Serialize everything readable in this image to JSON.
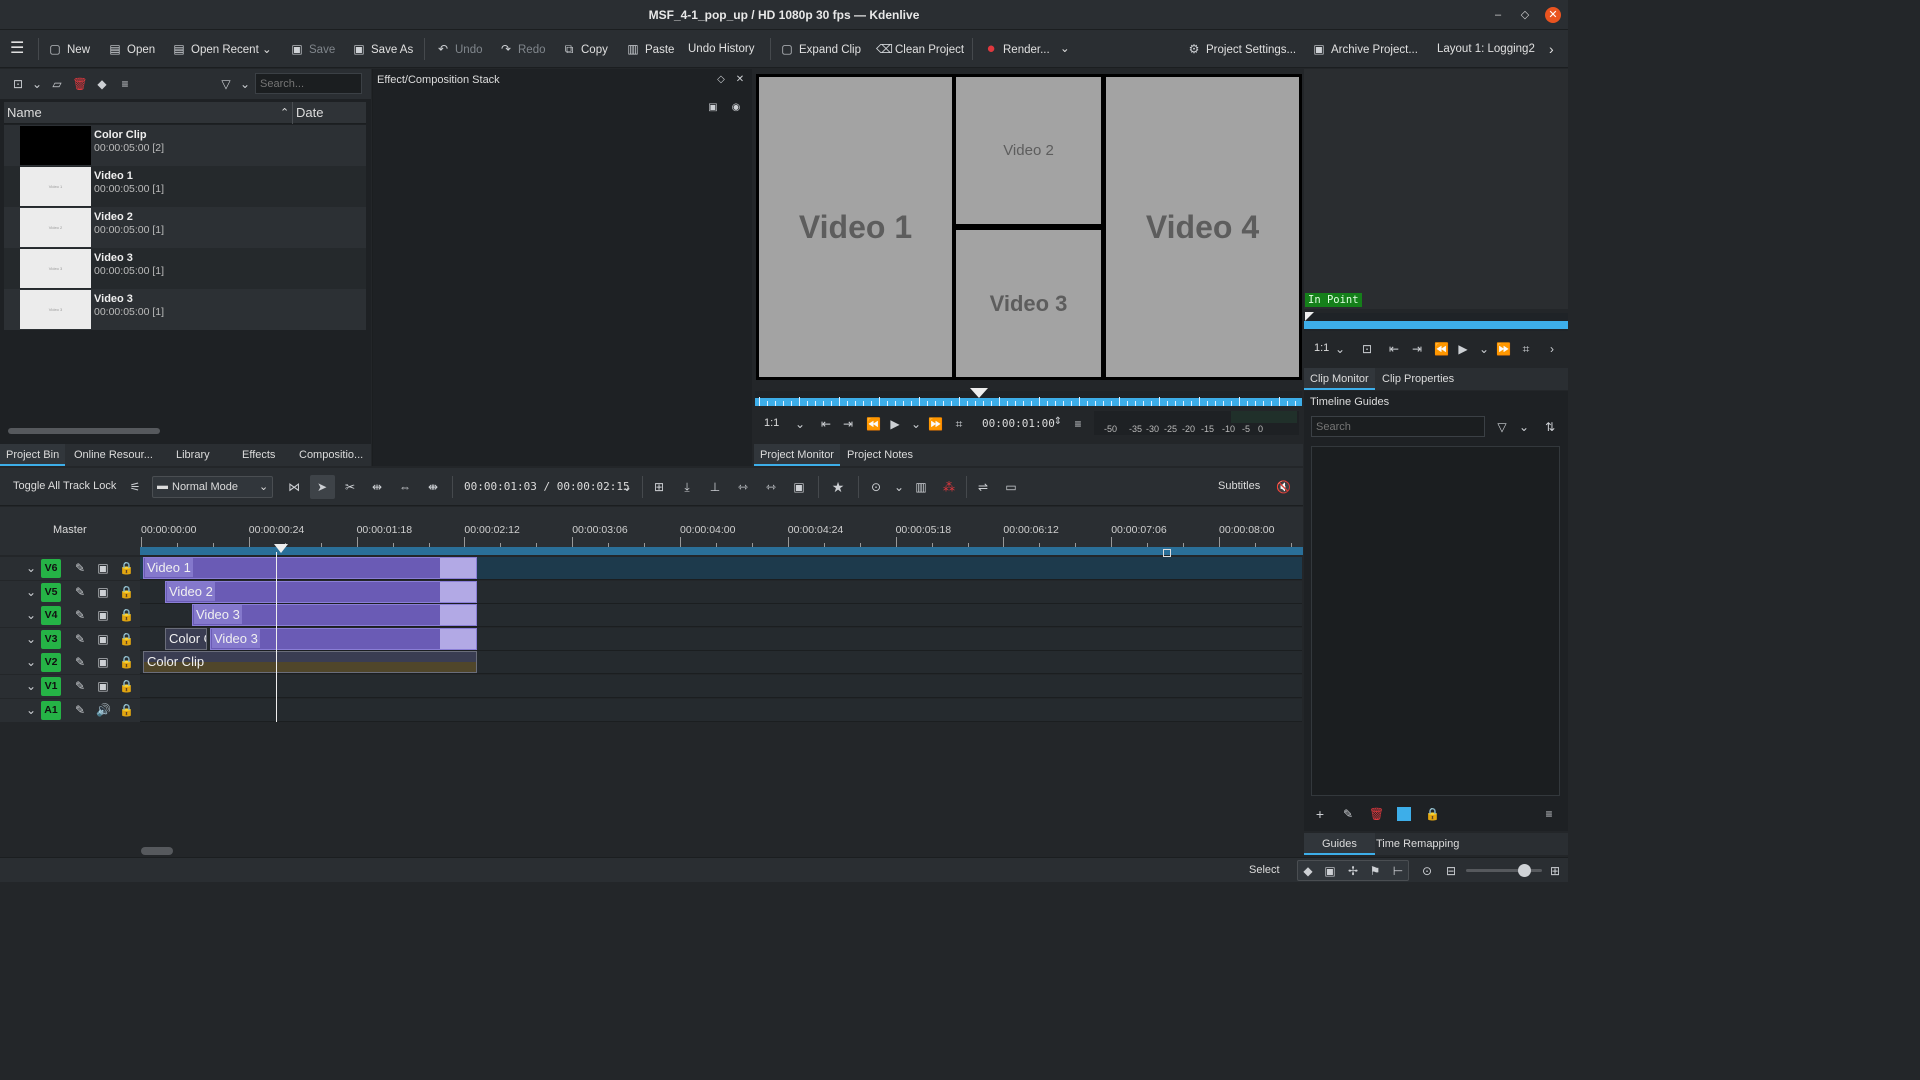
{
  "window": {
    "title": "MSF_4-1_pop_up / HD 1080p 30 fps — Kdenlive"
  },
  "toolbar": {
    "new": "New",
    "open": "Open",
    "open_recent": "Open Recent",
    "save": "Save",
    "save_as": "Save As",
    "undo": "Undo",
    "redo": "Redo",
    "copy": "Copy",
    "paste": "Paste",
    "undo_history": "Undo History",
    "expand_clip": "Expand Clip",
    "clean_project": "Clean Project",
    "render": "Render...",
    "project_settings": "Project Settings...",
    "archive_project": "Archive Project...",
    "layout": "Layout 1: Logging2"
  },
  "bin": {
    "search_placeholder": "Search...",
    "col_name": "Name",
    "col_date": "Date",
    "clips": [
      {
        "name": "Color Clip",
        "duration": "00:00:05:00 [2]",
        "thumb": ""
      },
      {
        "name": "Video 1",
        "duration": "00:00:05:00 [1]",
        "thumb": "Video 1"
      },
      {
        "name": "Video 2",
        "duration": "00:00:05:00 [1]",
        "thumb": "Video 2"
      },
      {
        "name": "Video 3",
        "duration": "00:00:05:00 [1]",
        "thumb": "Video 3"
      },
      {
        "name": "Video 3",
        "duration": "00:00:05:00 [1]",
        "thumb": "Video 3"
      }
    ],
    "tabs": [
      "Project Bin",
      "Online Resour...",
      "Library",
      "Effects",
      "Compositio..."
    ]
  },
  "effect_stack": {
    "title": "Effect/Composition Stack"
  },
  "project_monitor": {
    "tiles": [
      "Video 1",
      "Video 2",
      "Video 3",
      "Video 4"
    ],
    "zoom": "1:1",
    "timecode": "00:00:01:00",
    "scale": [
      "-50",
      "-35",
      "-30",
      "-25",
      "-20",
      "-15",
      "-10",
      "-5",
      "0"
    ],
    "playhead_fraction": 0.41,
    "tabs": [
      "Project Monitor",
      "Project Notes"
    ]
  },
  "clip_monitor": {
    "in_point": "In Point",
    "zoom": "1:1",
    "tabs": [
      "Clip Monitor",
      "Clip Properties"
    ]
  },
  "guides": {
    "title": "Timeline Guides",
    "search_placeholder": "Search",
    "tabs": [
      "Guides",
      "Time Remapping"
    ]
  },
  "timeline_toolbar": {
    "toggle_lock": "Toggle All Track Lock",
    "mode": "Normal Mode",
    "position": "00:00:01:03 / 00:00:02:15",
    "subtitles": "Subtitles"
  },
  "timeline": {
    "master": "Master",
    "ruler": [
      "00:00:00:00",
      "00:00:00:24",
      "00:00:01:18",
      "00:00:02:12",
      "00:00:03:06",
      "00:00:04:00",
      "00:00:04:24",
      "00:00:05:18",
      "00:00:06:12",
      "00:00:07:06",
      "00:00:08:00"
    ],
    "tracks": [
      {
        "label": "V6",
        "clips": [
          {
            "name": "Video 1"
          }
        ]
      },
      {
        "label": "V5",
        "clips": [
          {
            "name": "Video 2"
          }
        ]
      },
      {
        "label": "V4",
        "clips": [
          {
            "name": "Video 3"
          }
        ]
      },
      {
        "label": "V3",
        "clips": [
          {
            "name": "Color Clip"
          },
          {
            "name": "Video 3"
          }
        ]
      },
      {
        "label": "V2",
        "clips": [
          {
            "name": "Color Clip"
          }
        ]
      },
      {
        "label": "V1",
        "clips": []
      },
      {
        "label": "A1",
        "clips": []
      }
    ]
  },
  "statusbar": {
    "select": "Select"
  },
  "colors": {
    "accent": "#3daee9",
    "track_label": "#25b346",
    "clip": "#6a5bb5",
    "record": "#e0383e"
  }
}
